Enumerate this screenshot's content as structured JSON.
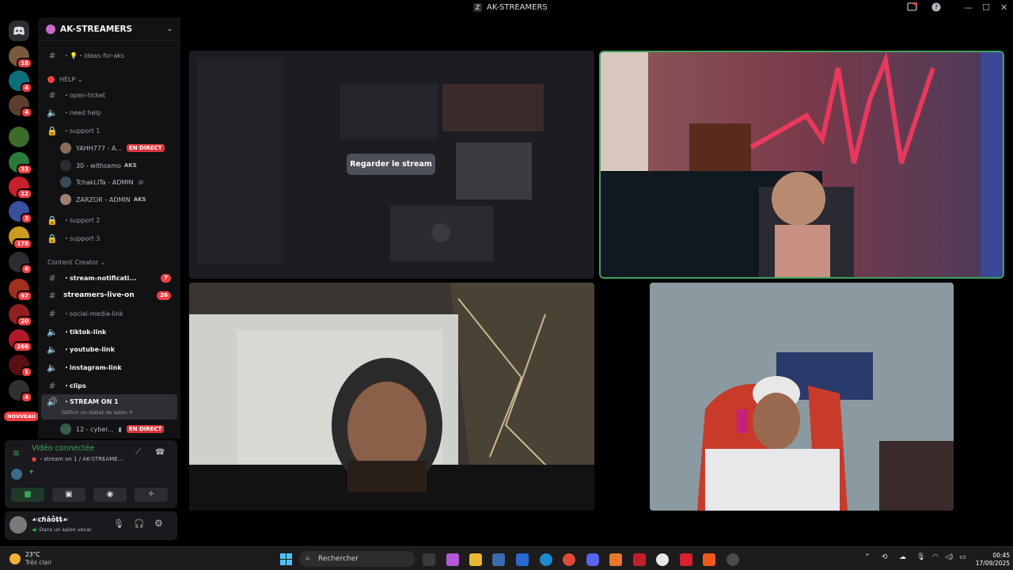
{
  "window": {
    "title": "AK-STREAMERS"
  },
  "servers": {
    "badges": [
      "18",
      "4",
      "4",
      "33",
      "12",
      "3",
      "178",
      "6",
      "67",
      "20",
      "266",
      "1",
      "4"
    ],
    "new_label": "NOUVEAU"
  },
  "sidebar": {
    "guild_name": "AK-STREAMERS",
    "channels": [
      {
        "label": "・💡・ideas-for-aks"
      },
      {
        "label": "HELP ⌄"
      },
      {
        "label": "・open-ticket"
      },
      {
        "label": "・need help"
      },
      {
        "label": "・support 1"
      },
      {
        "label": "・support 2"
      },
      {
        "label": "・support 3"
      },
      {
        "label": "Content Creator ⌄"
      },
      {
        "label": "・stream-notificati...",
        "count": "7"
      },
      {
        "label": "streamers-live-on",
        "count": "26"
      },
      {
        "label": "・social-media-link"
      },
      {
        "label": "・tiktok-link"
      },
      {
        "label": "・youtube-link"
      },
      {
        "label": "・instagram-link"
      },
      {
        "label": "・clips"
      },
      {
        "label": "・STREAM ON 1",
        "status": "Définir un statut de salon ✎"
      }
    ],
    "support_members": [
      {
        "name": "YAHH777 - A...",
        "badge": "EN DIRECT"
      },
      {
        "name": "30 - withsamo",
        "tag": "AKS"
      },
      {
        "name": "TchakLITa - ADMIN"
      },
      {
        "name": "ZARZOR - ADMIN",
        "tag": "AKS"
      }
    ],
    "stream_members": [
      {
        "name": "12 - cyber...",
        "badge": "EN DIRECT"
      }
    ]
  },
  "voice_panel": {
    "status": "Vidéo connectée",
    "channel": "・stream on 1 / AK-STREAME..."
  },
  "user_panel": {
    "username": "☙cℏâṑȶȶ☙",
    "status": "Dans un salon vocal"
  },
  "stage": {
    "watch_label": "Regarder le stream"
  },
  "taskbar": {
    "temp": "23°C",
    "weather": "Très clair",
    "search_placeholder": "Rechercher",
    "time": "00:45",
    "date": "17/09/2025"
  },
  "colors": {
    "live_red": "#da373c",
    "connected_green": "#3fa45c",
    "speaking_border": "#3fa45c",
    "badge_red": "#f23f43"
  }
}
